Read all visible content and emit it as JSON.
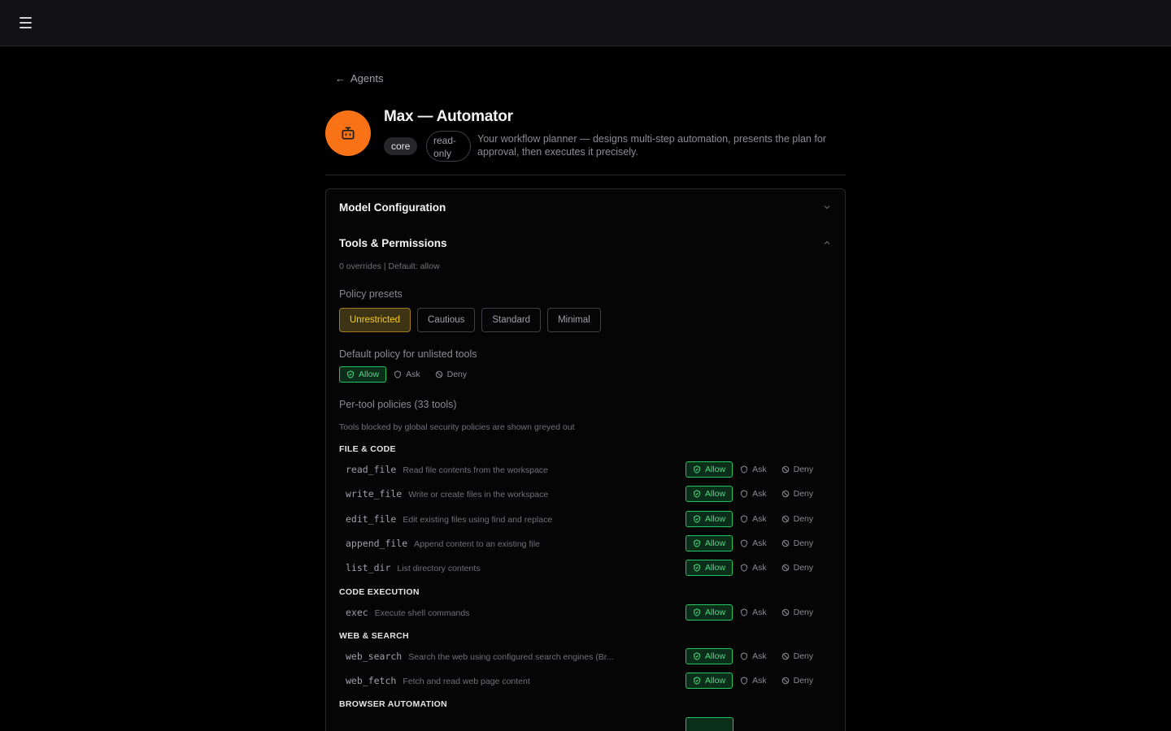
{
  "nav": {
    "back_label": "Agents"
  },
  "agent": {
    "name": "Max — Automator",
    "badge_core": "core",
    "badge_readonly": "read-only",
    "description": "Your workflow planner — designs multi-step automation, presents the plan for approval, then executes it precisely.",
    "avatar_color": "#f97316"
  },
  "sections": {
    "model_config": "Model Configuration",
    "tools_permissions": "Tools & Permissions"
  },
  "tools": {
    "summary": "0 overrides | Default: allow",
    "presets_label": "Policy presets",
    "presets": [
      "Unrestricted",
      "Cautious",
      "Standard",
      "Minimal"
    ],
    "active_preset": "Unrestricted",
    "default_label": "Default policy for unlisted tools",
    "per_tool_label": "Per-tool policies (33 tools)",
    "blocked_note": "Tools blocked by global security policies are shown greyed out",
    "policy_labels": {
      "allow": "Allow",
      "ask": "Ask",
      "deny": "Deny"
    },
    "categories": [
      {
        "name": "FILE & CODE",
        "items": [
          {
            "name": "read_file",
            "desc": "Read file contents from the workspace"
          },
          {
            "name": "write_file",
            "desc": "Write or create files in the workspace"
          },
          {
            "name": "edit_file",
            "desc": "Edit existing files using find and replace"
          },
          {
            "name": "append_file",
            "desc": "Append content to an existing file"
          },
          {
            "name": "list_dir",
            "desc": "List directory contents"
          }
        ]
      },
      {
        "name": "CODE EXECUTION",
        "items": [
          {
            "name": "exec",
            "desc": "Execute shell commands"
          }
        ]
      },
      {
        "name": "WEB & SEARCH",
        "items": [
          {
            "name": "web_search",
            "desc": "Search the web using configured search engines (Br..."
          },
          {
            "name": "web_fetch",
            "desc": "Fetch and read web page content"
          }
        ]
      },
      {
        "name": "BROWSER AUTOMATION",
        "items": []
      }
    ]
  }
}
